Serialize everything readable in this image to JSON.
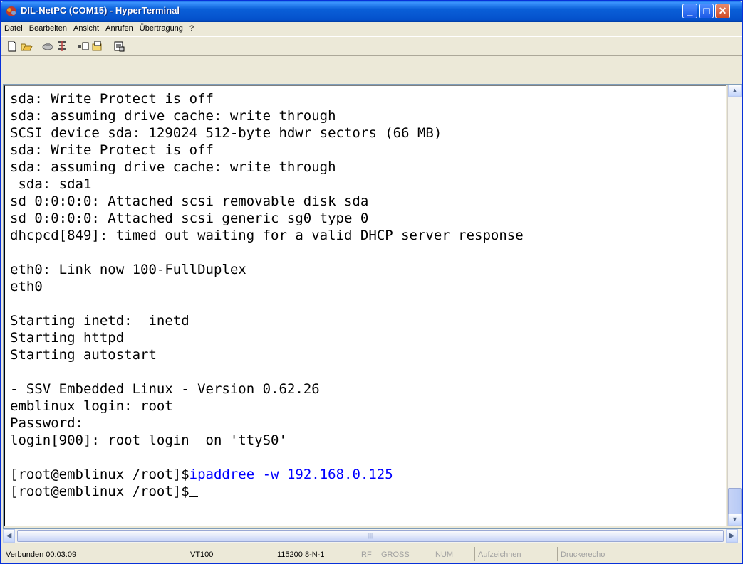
{
  "window": {
    "title": "DIL-NetPC (COM15) - HyperTerminal",
    "controls": {
      "minimize": "_",
      "maximize": "□",
      "close": "✕"
    }
  },
  "menu": [
    "Datei",
    "Bearbeiten",
    "Ansicht",
    "Anrufen",
    "Übertragung",
    "?"
  ],
  "toolbar": [
    "new-icon",
    "open-icon",
    "disconnect-icon",
    "dial-icon",
    "send-icon",
    "receive-icon",
    "properties-icon"
  ],
  "terminal": {
    "lines": [
      "sda: Write Protect is off",
      "sda: assuming drive cache: write through",
      "SCSI device sda: 129024 512-byte hdwr sectors (66 MB)",
      "sda: Write Protect is off",
      "sda: assuming drive cache: write through",
      " sda: sda1",
      "sd 0:0:0:0: Attached scsi removable disk sda",
      "sd 0:0:0:0: Attached scsi generic sg0 type 0",
      "dhcpcd[849]: timed out waiting for a valid DHCP server response",
      "",
      "eth0: Link now 100-FullDuplex",
      "eth0",
      "",
      "Starting inetd:  inetd",
      "Starting httpd",
      "Starting autostart",
      "",
      "- SSV Embedded Linux - Version 0.62.26",
      "emblinux login: root",
      "Password:",
      "login[900]: root login  on 'ttyS0'",
      ""
    ],
    "command_prompt": "[root@emblinux /root]$",
    "command": "ipaddree -w 192.168.0.125",
    "final_prompt": "[root@emblinux /root]$",
    "command_color": "#0000ff"
  },
  "status": {
    "connected": "Verbunden 00:03:09",
    "emulation": "VT100",
    "settings": "115200 8-N-1",
    "rf": "RF",
    "gross": "GROSS",
    "num": "NUM",
    "capture": "Aufzeichnen",
    "print_echo": "Druckerecho"
  }
}
